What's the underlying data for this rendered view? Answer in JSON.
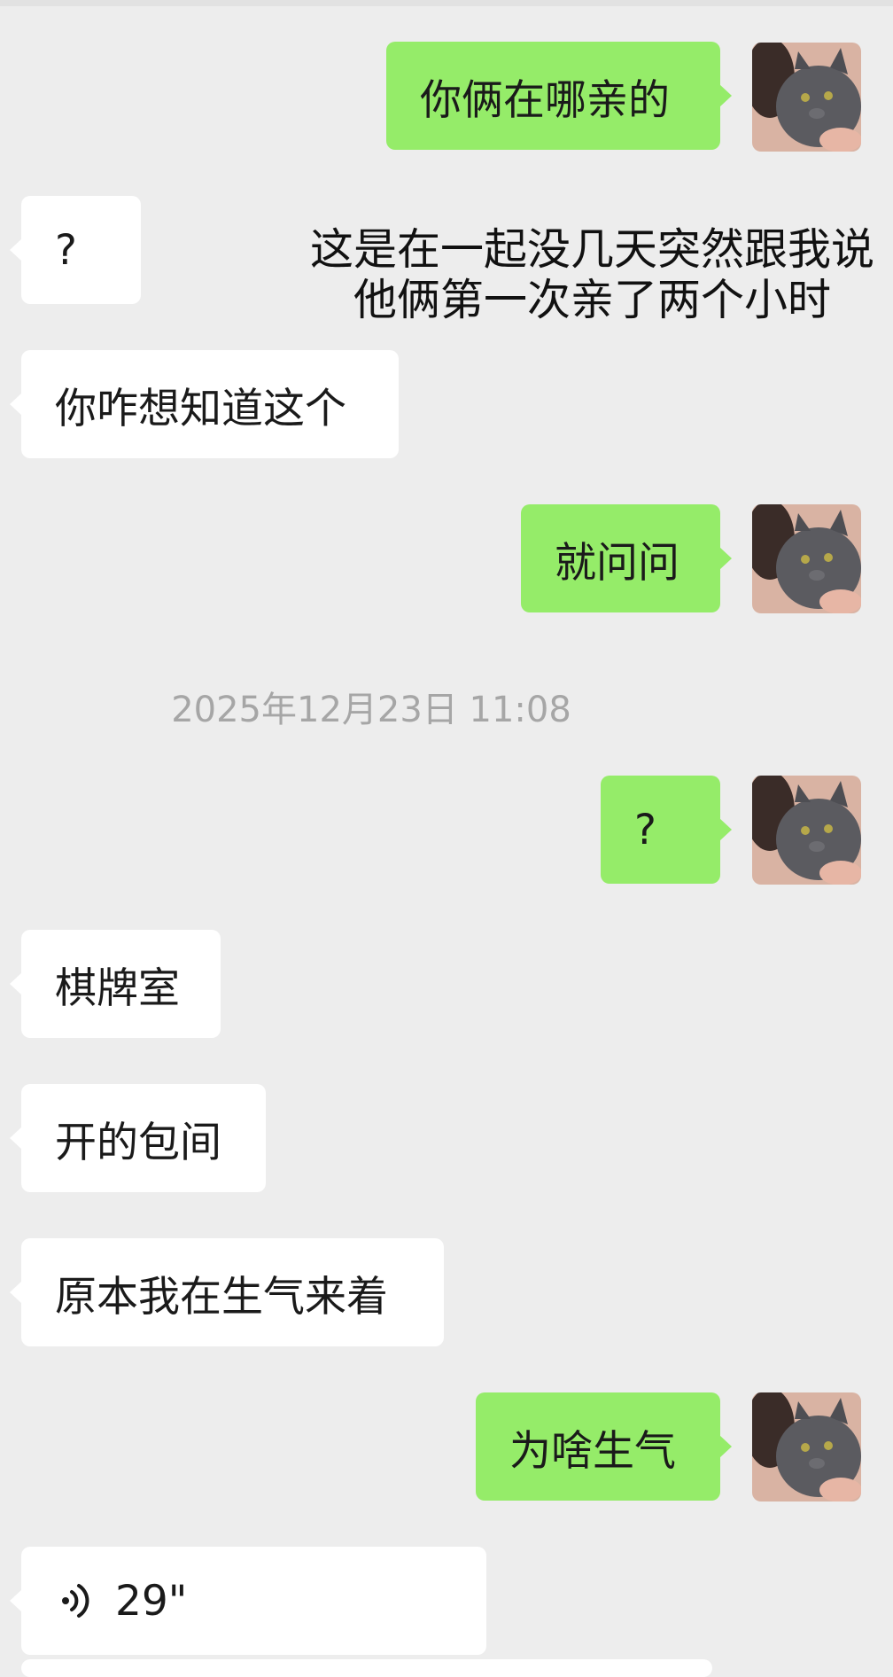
{
  "messages": {
    "m1": "你俩在哪亲的",
    "m2": "?",
    "m3": "你咋想知道这个",
    "m4": "就问问",
    "m5": "?",
    "m6": "棋牌室",
    "m7": "开的包间",
    "m8": "原本我在生气来着",
    "m9": "为啥生气",
    "voice_duration": "29\""
  },
  "caption": {
    "line1": "这是在一起没几天突然跟我说",
    "line2": "他俩第一次亲了两个小时"
  },
  "timestamp": "2025年12月23日 11:08",
  "colors": {
    "background": "#ededed",
    "outgoing_bubble": "#95ec69",
    "incoming_bubble": "#ffffff",
    "timestamp_text": "#a6a6a6"
  },
  "icons": {
    "avatar": "cat-avatar-icon",
    "voice": "voice-wave-icon"
  }
}
